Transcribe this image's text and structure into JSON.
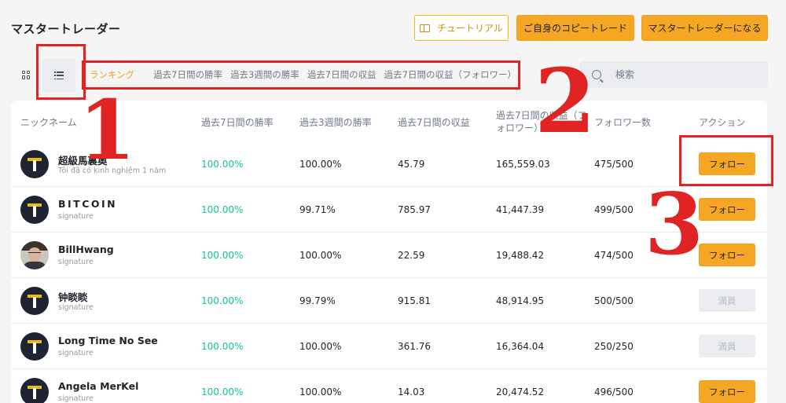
{
  "header": {
    "title": "マスタートレーダー",
    "tutorial_label": "チュートリアル",
    "copy_trade_label": "ご自身のコピートレード",
    "become_master_label": "マスタートレーダーになる"
  },
  "toolbar": {
    "ranking_tabs": [
      "ランキング",
      "過去7日間の勝率",
      "過去3週間の勝率",
      "過去7日間の収益",
      "過去7日間の収益（フォロワー）"
    ],
    "search_placeholder": "検索"
  },
  "annotations": [
    "1",
    "2",
    "3"
  ],
  "table": {
    "headers": {
      "nickname": "ニックネーム",
      "win7": "過去7日間の勝率",
      "win3w": "過去3週間の勝率",
      "profit7": "過去7日間の収益",
      "profit_follow": "過去7日間の収益（フォロワー）",
      "followers": "フォロワー数",
      "action": "アクション"
    },
    "rows": [
      {
        "name": "超級馬裏奧",
        "sub": "Tôi đã có kinh nghiệm 1 năm",
        "win7": "100.00%",
        "win3w": "100.00%",
        "profit7": "45.79",
        "profit_follow": "165,559.03",
        "followers": "475/500",
        "action": "フォロー"
      },
      {
        "name": "BITCOIN",
        "sub": "signature",
        "win7": "100.00%",
        "win3w": "99.71%",
        "profit7": "785.97",
        "profit_follow": "41,447.39",
        "followers": "499/500",
        "action": "フォロー"
      },
      {
        "name": "BillHwang",
        "sub": "signature",
        "win7": "100.00%",
        "win3w": "100.00%",
        "profit7": "22.59",
        "profit_follow": "19,488.42",
        "followers": "474/500",
        "action": "フォロー"
      },
      {
        "name": "钟睒睒",
        "sub": "signature",
        "win7": "100.00%",
        "win3w": "99.79%",
        "profit7": "915.81",
        "profit_follow": "48,914.95",
        "followers": "500/500",
        "action": "満員"
      },
      {
        "name": "Long Time No See",
        "sub": "signature",
        "win7": "100.00%",
        "win3w": "100.00%",
        "profit7": "361.76",
        "profit_follow": "16,364.04",
        "followers": "250/250",
        "action": "満員"
      },
      {
        "name": "Angela MerKel",
        "sub": "signature",
        "win7": "100.00%",
        "win3w": "100.00%",
        "profit7": "14.03",
        "profit_follow": "20,474.52",
        "followers": "496/500",
        "action": "フォロー"
      }
    ]
  },
  "colors": {
    "accent": "#f5a623",
    "positive": "#0ecb81",
    "annotation": "#e02424"
  }
}
